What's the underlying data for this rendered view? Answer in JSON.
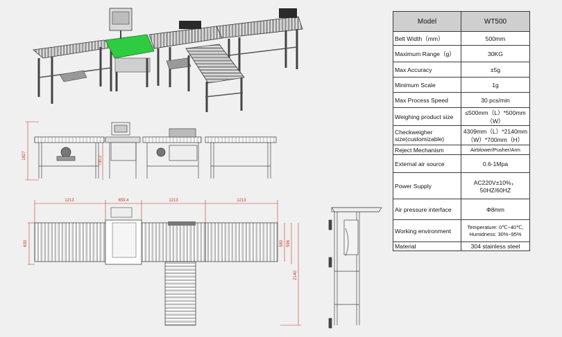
{
  "drawing": {
    "front_view": {
      "height_total": "1827",
      "height_weigher": "730.2"
    },
    "top_view": {
      "segment_lengths": [
        "1213",
        "659.4",
        "1213",
        "1213"
      ],
      "width_left": "630",
      "width_right_a": "580",
      "width_right_b": "596",
      "total_depth": "2140"
    }
  },
  "spec_table": {
    "header": {
      "model_label": "Model",
      "model_value": "WT500"
    },
    "rows": [
      {
        "label": "Belt Width（mm）",
        "value": "500mm"
      },
      {
        "label": "Maximum Range（g）",
        "value": "30KG"
      },
      {
        "label": "Max Accuracy",
        "value": "±5g"
      },
      {
        "label": "Minimum Scale",
        "value": "1g"
      },
      {
        "label": "Max Process Speed",
        "value": "30 pcs/min"
      },
      {
        "label": "Weighing product size",
        "value": "≤500mm（L）*500mm（W）"
      },
      {
        "label": "Checkweigher size(customizable)",
        "value": "4309mm（L）*2140mm（W）*700mm（H）"
      },
      {
        "label": "Reject Mechanism",
        "value": "Airblower/Pusher/Arm"
      },
      {
        "label": "External air source",
        "value": "0.6-1Mpa"
      },
      {
        "label": "Power Supply",
        "value": "AC220V±10%，50HZ/60HZ"
      },
      {
        "label": "Air pressure interface",
        "value": "Φ8mm"
      },
      {
        "label": "Working environment",
        "value": "Temperature: 0℃~40℃, Humidness: 30%~95%"
      },
      {
        "label": "Material",
        "value": "304 stainless steel"
      }
    ]
  }
}
